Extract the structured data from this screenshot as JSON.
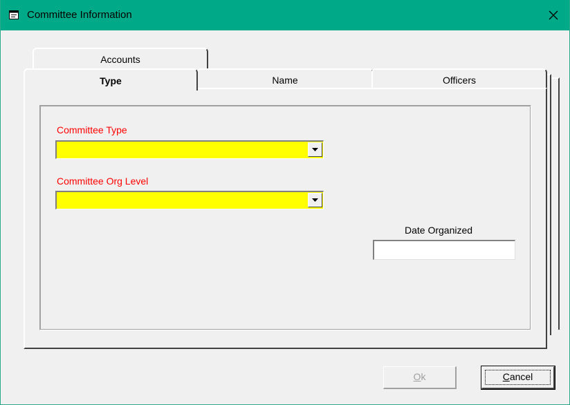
{
  "window": {
    "title": "Committee Information",
    "close_glyph": "✕",
    "icon": "form-icon"
  },
  "tabs": {
    "back_row": [
      {
        "label": "Accounts"
      }
    ],
    "front_row": [
      {
        "label": "Type",
        "active": true
      },
      {
        "label": "Name",
        "active": false
      },
      {
        "label": "Officers",
        "active": false
      }
    ]
  },
  "form": {
    "committee_type": {
      "label": "Committee Type",
      "value": "",
      "required_color": "#ff0000",
      "fill_color": "#ffff00"
    },
    "committee_org_level": {
      "label": "Committee Org Level",
      "value": "",
      "required_color": "#ff0000",
      "fill_color": "#ffff00"
    },
    "date_organized": {
      "label": "Date Organized",
      "value": ""
    }
  },
  "buttons": {
    "ok": {
      "mnemonic": "O",
      "rest": "k",
      "enabled": false
    },
    "cancel": {
      "mnemonic": "C",
      "rest": "ancel",
      "enabled": true
    }
  },
  "colors": {
    "titlebar": "#00aa88",
    "window_bg": "#f0f0f0"
  }
}
